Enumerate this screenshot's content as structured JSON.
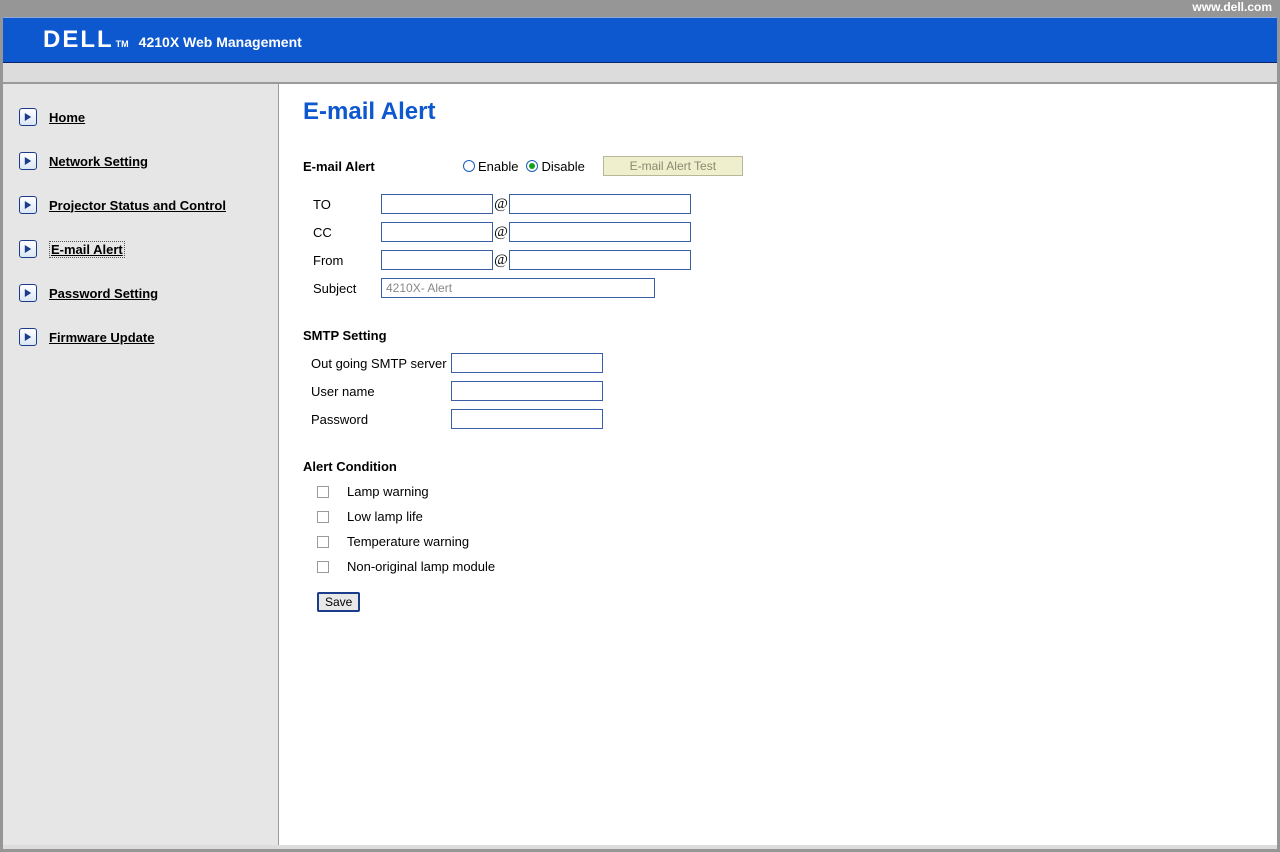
{
  "top_url": "www.dell.com",
  "header": {
    "brand": "DELL",
    "tm": "TM",
    "subtitle": "4210X Web Management"
  },
  "sidebar": {
    "items": [
      {
        "label": "Home",
        "active": false
      },
      {
        "label": "Network Setting",
        "active": false
      },
      {
        "label": "Projector Status and Control",
        "active": false
      },
      {
        "label": "E-mail Alert",
        "active": true
      },
      {
        "label": "Password Setting",
        "active": false
      },
      {
        "label": "Firmware Update",
        "active": false
      }
    ]
  },
  "page": {
    "title": "E-mail Alert",
    "alert_section_label": "E-mail Alert",
    "enable_label": "Enable",
    "disable_label": "Disable",
    "selected_mode": "disable",
    "test_button": "E-mail Alert Test",
    "fields": {
      "to_label": "TO",
      "cc_label": "CC",
      "from_label": "From",
      "subject_label": "Subject",
      "subject_value": "4210X- Alert",
      "at": "@"
    },
    "smtp": {
      "title": "SMTP Setting",
      "server_label": "Out going SMTP server",
      "user_label": "User name",
      "pass_label": "Password"
    },
    "alert_condition": {
      "title": "Alert Condition",
      "items": [
        "Lamp warning",
        "Low lamp life",
        "Temperature warning",
        "Non-original lamp module"
      ]
    },
    "save_label": "Save"
  }
}
